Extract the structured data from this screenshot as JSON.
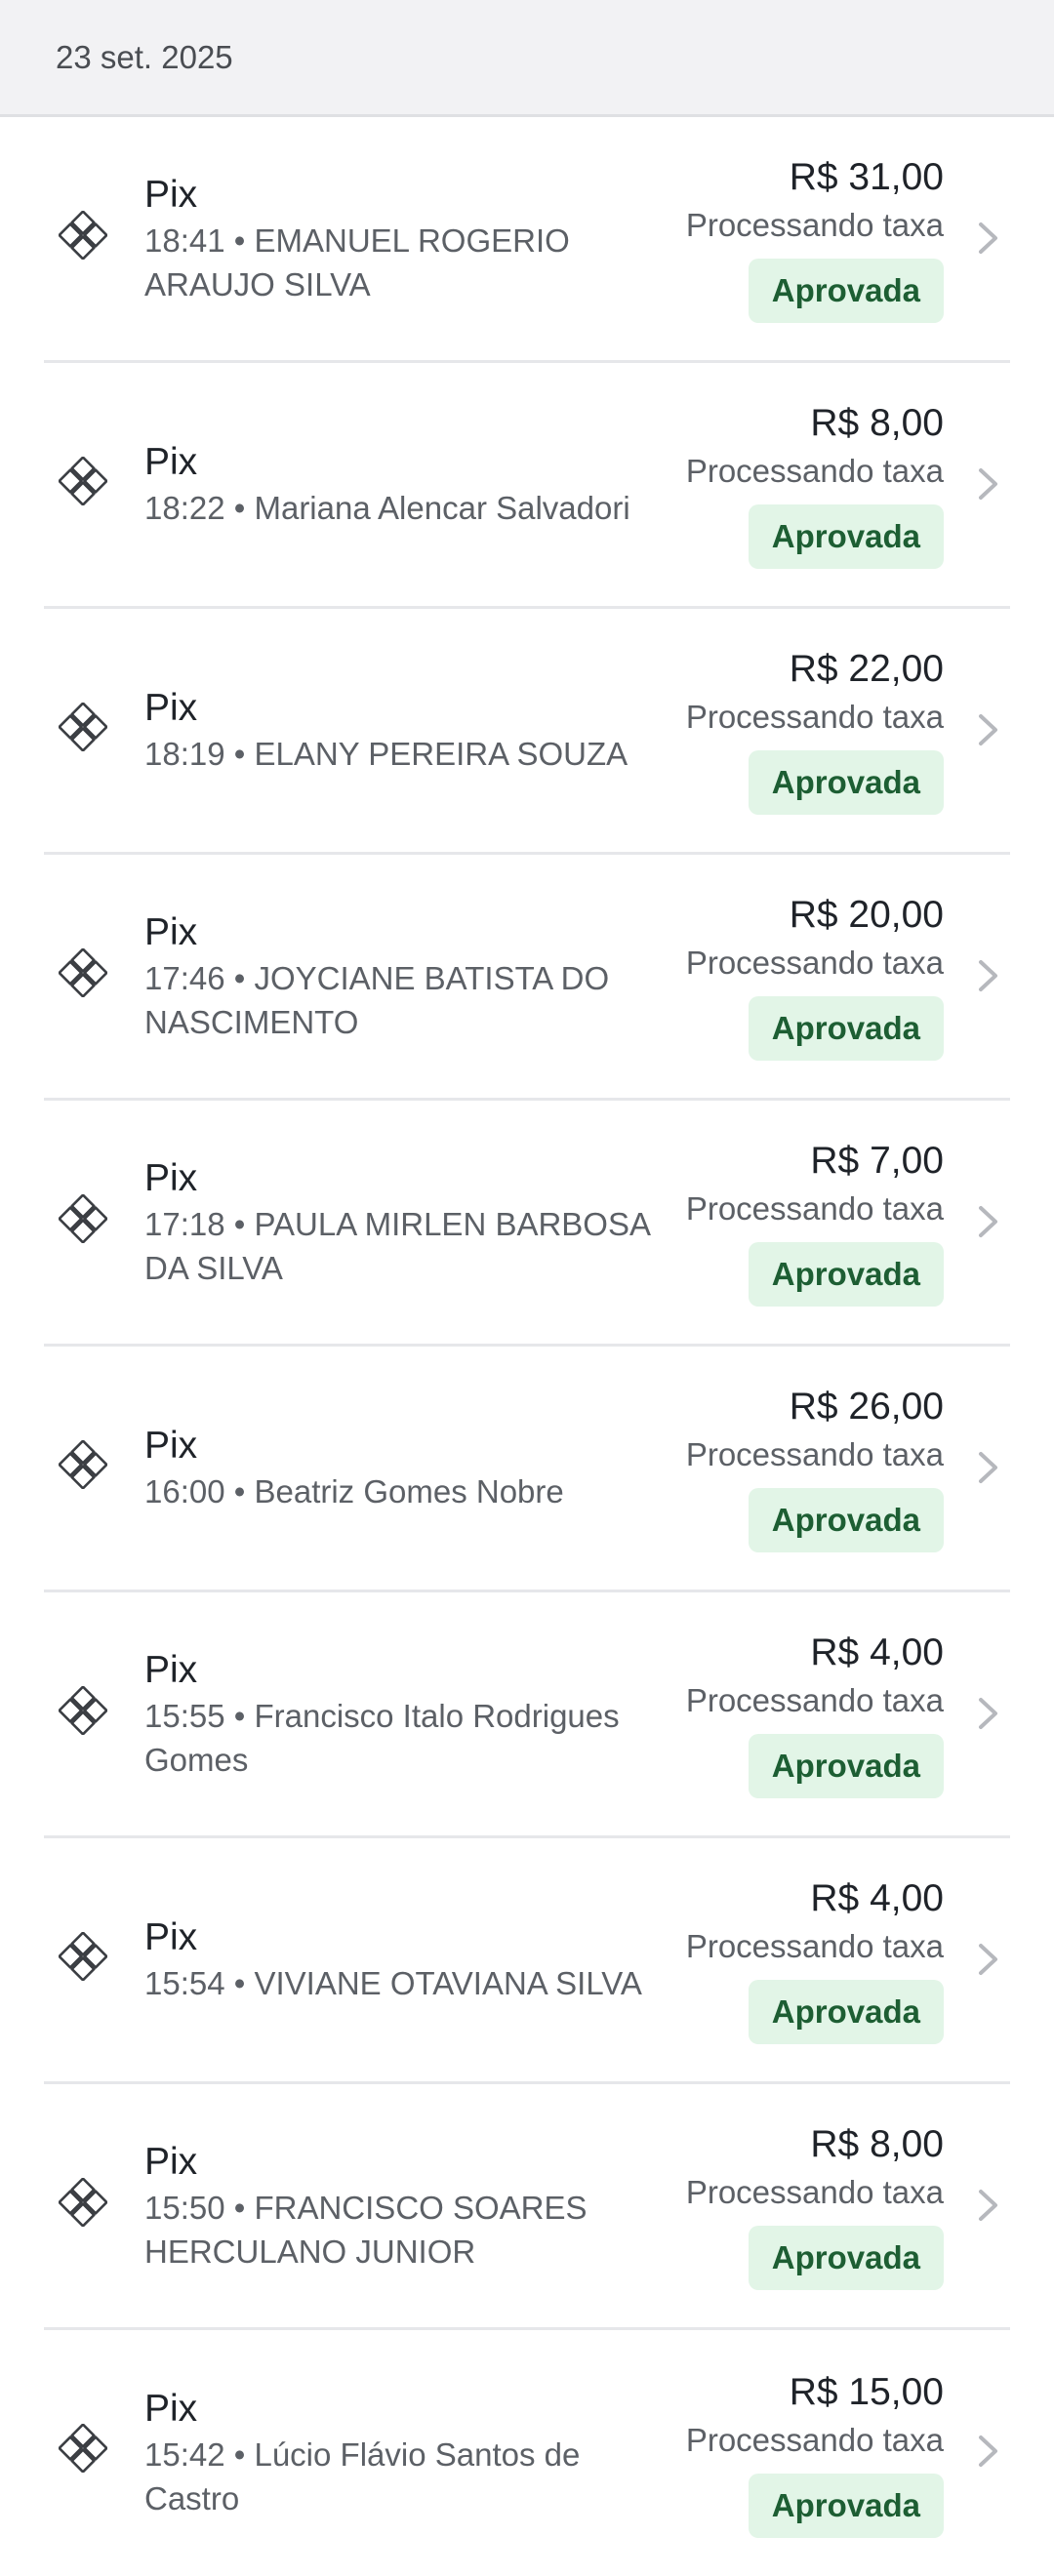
{
  "header": {
    "date": "23 set. 2025"
  },
  "colors": {
    "accent_badge_bg": "#e2f5e7",
    "accent_badge_text": "#1d5e33"
  },
  "transactions": [
    {
      "method": "Pix",
      "detail": "18:41 • EMANUEL ROGERIO ARAUJO SILVA",
      "amount": "R$ 31,00",
      "fee_status": "Processando taxa",
      "status": "Aprovada"
    },
    {
      "method": "Pix",
      "detail": "18:22 • Mariana Alencar Salvadori",
      "amount": "R$ 8,00",
      "fee_status": "Processando taxa",
      "status": "Aprovada"
    },
    {
      "method": "Pix",
      "detail": "18:19 • ELANY PEREIRA SOUZA",
      "amount": "R$ 22,00",
      "fee_status": "Processando taxa",
      "status": "Aprovada"
    },
    {
      "method": "Pix",
      "detail": "17:46 • JOYCIANE BATISTA DO NASCIMENTO",
      "amount": "R$ 20,00",
      "fee_status": "Processando taxa",
      "status": "Aprovada"
    },
    {
      "method": "Pix",
      "detail": "17:18 • PAULA MIRLEN BARBOSA DA SILVA",
      "amount": "R$ 7,00",
      "fee_status": "Processando taxa",
      "status": "Aprovada"
    },
    {
      "method": "Pix",
      "detail": "16:00 • Beatriz Gomes Nobre",
      "amount": "R$ 26,00",
      "fee_status": "Processando taxa",
      "status": "Aprovada"
    },
    {
      "method": "Pix",
      "detail": "15:55 • Francisco Italo Rodrigues Gomes",
      "amount": "R$ 4,00",
      "fee_status": "Processando taxa",
      "status": "Aprovada"
    },
    {
      "method": "Pix",
      "detail": "15:54 • VIVIANE OTAVIANA SILVA",
      "amount": "R$ 4,00",
      "fee_status": "Processando taxa",
      "status": "Aprovada"
    },
    {
      "method": "Pix",
      "detail": "15:50 • FRANCISCO SOARES HERCULANO JUNIOR",
      "amount": "R$ 8,00",
      "fee_status": "Processando taxa",
      "status": "Aprovada"
    },
    {
      "method": "Pix",
      "detail": "15:42 • Lúcio Flávio Santos de Castro",
      "amount": "R$ 15,00",
      "fee_status": "Processando taxa",
      "status": "Aprovada"
    }
  ]
}
